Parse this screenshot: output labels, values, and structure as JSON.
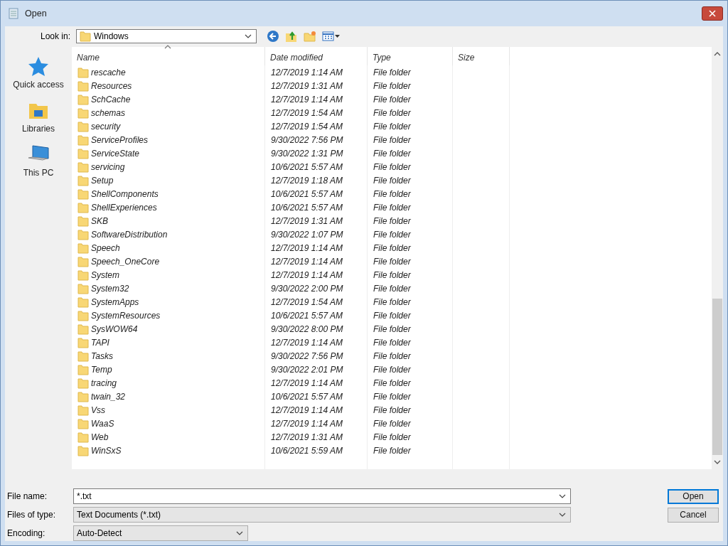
{
  "window": {
    "title": "Open"
  },
  "look_in": {
    "label": "Look in:",
    "value": "Windows"
  },
  "places": [
    {
      "label": "Quick access",
      "kind": "star"
    },
    {
      "label": "Libraries",
      "kind": "libraries"
    },
    {
      "label": "This PC",
      "kind": "computer"
    }
  ],
  "columns": [
    {
      "label": "Name",
      "sorted": true
    },
    {
      "label": "Date modified",
      "sorted": false
    },
    {
      "label": "Type",
      "sorted": false
    },
    {
      "label": "Size",
      "sorted": false
    }
  ],
  "rows": [
    {
      "name": "rescache",
      "date": "12/7/2019 1:14 AM",
      "type": "File folder"
    },
    {
      "name": "Resources",
      "date": "12/7/2019 1:31 AM",
      "type": "File folder"
    },
    {
      "name": "SchCache",
      "date": "12/7/2019 1:14 AM",
      "type": "File folder"
    },
    {
      "name": "schemas",
      "date": "12/7/2019 1:54 AM",
      "type": "File folder"
    },
    {
      "name": "security",
      "date": "12/7/2019 1:54 AM",
      "type": "File folder"
    },
    {
      "name": "ServiceProfiles",
      "date": "9/30/2022 7:56 PM",
      "type": "File folder"
    },
    {
      "name": "ServiceState",
      "date": "9/30/2022 1:31 PM",
      "type": "File folder"
    },
    {
      "name": "servicing",
      "date": "10/6/2021 5:57 AM",
      "type": "File folder"
    },
    {
      "name": "Setup",
      "date": "12/7/2019 1:18 AM",
      "type": "File folder"
    },
    {
      "name": "ShellComponents",
      "date": "10/6/2021 5:57 AM",
      "type": "File folder"
    },
    {
      "name": "ShellExperiences",
      "date": "10/6/2021 5:57 AM",
      "type": "File folder"
    },
    {
      "name": "SKB",
      "date": "12/7/2019 1:31 AM",
      "type": "File folder"
    },
    {
      "name": "SoftwareDistribution",
      "date": "9/30/2022 1:07 PM",
      "type": "File folder"
    },
    {
      "name": "Speech",
      "date": "12/7/2019 1:14 AM",
      "type": "File folder"
    },
    {
      "name": "Speech_OneCore",
      "date": "12/7/2019 1:14 AM",
      "type": "File folder"
    },
    {
      "name": "System",
      "date": "12/7/2019 1:14 AM",
      "type": "File folder"
    },
    {
      "name": "System32",
      "date": "9/30/2022 2:00 PM",
      "type": "File folder"
    },
    {
      "name": "SystemApps",
      "date": "12/7/2019 1:54 AM",
      "type": "File folder"
    },
    {
      "name": "SystemResources",
      "date": "10/6/2021 5:57 AM",
      "type": "File folder"
    },
    {
      "name": "SysWOW64",
      "date": "9/30/2022 8:00 PM",
      "type": "File folder"
    },
    {
      "name": "TAPI",
      "date": "12/7/2019 1:14 AM",
      "type": "File folder"
    },
    {
      "name": "Tasks",
      "date": "9/30/2022 7:56 PM",
      "type": "File folder"
    },
    {
      "name": "Temp",
      "date": "9/30/2022 2:01 PM",
      "type": "File folder"
    },
    {
      "name": "tracing",
      "date": "12/7/2019 1:14 AM",
      "type": "File folder"
    },
    {
      "name": "twain_32",
      "date": "10/6/2021 5:57 AM",
      "type": "File folder"
    },
    {
      "name": "Vss",
      "date": "12/7/2019 1:14 AM",
      "type": "File folder"
    },
    {
      "name": "WaaS",
      "date": "12/7/2019 1:14 AM",
      "type": "File folder"
    },
    {
      "name": "Web",
      "date": "12/7/2019 1:31 AM",
      "type": "File folder"
    },
    {
      "name": "WinSxS",
      "date": "10/6/2021 5:59 AM",
      "type": "File folder"
    }
  ],
  "fields": [
    {
      "label": "File name:",
      "value": "*.txt",
      "kind": "combo"
    },
    {
      "label": "Files of type:",
      "value": "Text Documents (*.txt)",
      "kind": "dropdown"
    },
    {
      "label": "Encoding:",
      "value": "Auto-Detect",
      "kind": "short-dropdown"
    }
  ],
  "buttons": [
    {
      "label": "Open",
      "default": true
    },
    {
      "label": "Cancel",
      "default": false
    }
  ]
}
